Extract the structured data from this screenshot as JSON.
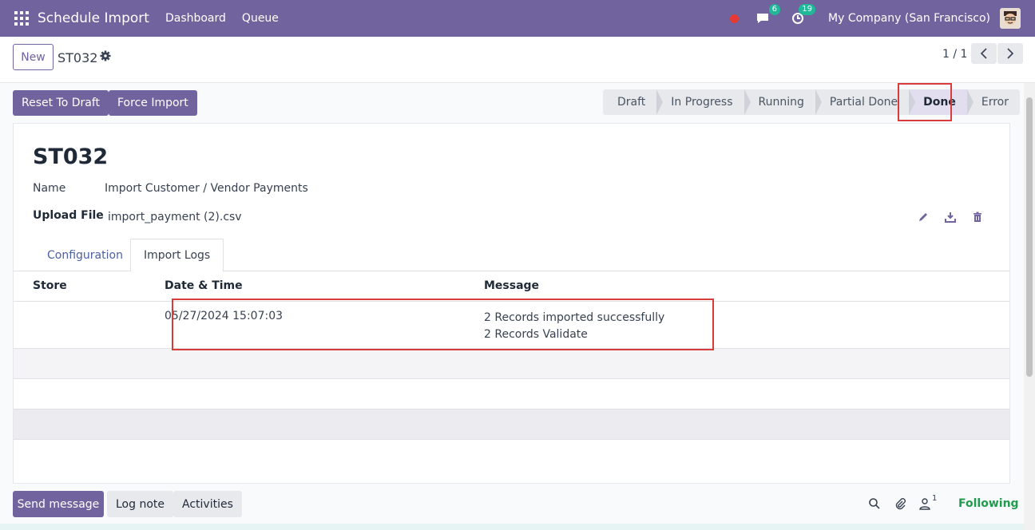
{
  "topbar": {
    "app_title": "Schedule Import",
    "nav": [
      "Dashboard",
      "Queue"
    ],
    "messages_count": "6",
    "activities_count": "19",
    "company": "My Company (San Francisco)"
  },
  "control": {
    "new_label": "New",
    "record_name": "ST032",
    "pager": "1 / 1"
  },
  "actions": {
    "reset_label": "Reset To Draft",
    "force_label": "Force Import"
  },
  "status": {
    "stages": [
      "Draft",
      "In Progress",
      "Running",
      "Partial Done",
      "Done",
      "Error"
    ],
    "active": "Done"
  },
  "form": {
    "title": "ST032",
    "name_label": "Name",
    "name_value": "Import Customer / Vendor Payments",
    "file_label": "Upload File",
    "file_value": "import_payment (2).csv"
  },
  "tabs": {
    "configuration": "Configuration",
    "import_logs": "Import Logs"
  },
  "logs": {
    "columns": [
      "Store",
      "Date & Time",
      "Message"
    ],
    "rows": [
      {
        "store": "",
        "datetime": "05/27/2024 15:07:03",
        "message_lines": [
          "2 Records imported successfully",
          "2 Records Validate"
        ]
      }
    ]
  },
  "chatter": {
    "send_label": "Send message",
    "log_label": "Log note",
    "activities_label": "Activities",
    "followers_count": "1",
    "following_label": "Following"
  },
  "colors": {
    "brand": "#71639e",
    "highlight": "#d93b3b",
    "following": "#1f9d4c"
  }
}
